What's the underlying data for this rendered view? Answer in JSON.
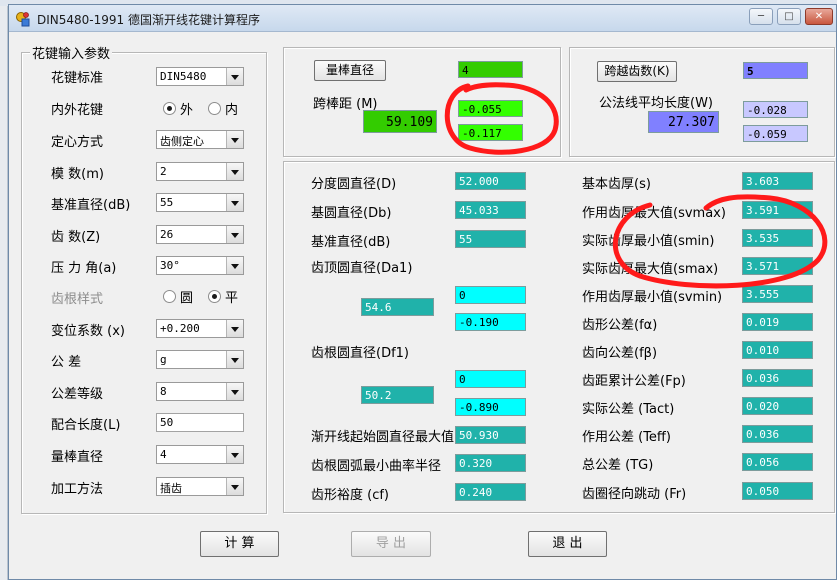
{
  "window": {
    "title": "DIN5480-1991 德国渐开线花键计算程序",
    "controls": [
      "─",
      "□",
      "✕"
    ]
  },
  "input_group": {
    "title": "花键输入参数",
    "rows": [
      {
        "label": "花键标准",
        "value": "DIN5480"
      },
      {
        "label": "内外花键",
        "radio": [
          "外",
          "内"
        ],
        "selected": "外"
      },
      {
        "label": "定心方式",
        "value": "齿侧定心"
      },
      {
        "label": "模     数(m)",
        "value": "2"
      },
      {
        "label": "基准直径(dB)",
        "value": "55"
      },
      {
        "label": "齿     数(Z)",
        "value": "26"
      },
      {
        "label": "压 力 角(a)",
        "value": "30°"
      },
      {
        "label": "齿根样式",
        "radio": [
          "圆",
          "平"
        ],
        "selected": "平"
      },
      {
        "label": "变位系数 (x)",
        "value": "+0.200"
      },
      {
        "label": "公     差",
        "value": "g"
      },
      {
        "label": "公差等级",
        "value": "8"
      },
      {
        "label": "配合长度(L)",
        "value": "50"
      },
      {
        "label": "量棒直径",
        "value": "4"
      },
      {
        "label": "加工方法",
        "value": "插齿"
      }
    ]
  },
  "pin_group": {
    "button_label": "量棒直径",
    "diameter_value": "4",
    "distance_label": "跨棒距 (M)",
    "distance_value": "59.109",
    "dev_upper": "-0.055",
    "dev_lower": "-0.117"
  },
  "span_group": {
    "button_label": "跨越齿数(K)",
    "k_value": "5",
    "length_label": "公法线平均长度(W)",
    "length_value": "27.307",
    "dev_upper": "-0.028",
    "dev_lower": "-0.059"
  },
  "results_left": {
    "pitch_diameter": {
      "label": "分度圆直径(D)",
      "value": "52.000"
    },
    "base_diameter": {
      "label": "基圆直径(Db)",
      "value": "45.033"
    },
    "reference_diameter": {
      "label": "基准直径(dB)",
      "value": "55"
    },
    "tip_diameter": {
      "label": "齿顶圆直径(Da1)",
      "value": "54.6",
      "dev_upper": "0",
      "dev_lower": "-0.190"
    },
    "root_diameter": {
      "label": "齿根圆直径(Df1)",
      "value": "50.2",
      "dev_upper": "0",
      "dev_lower": "-0.890"
    },
    "form_diameter": {
      "label": "渐开线起始圆直径最大值",
      "value": "50.930"
    },
    "root_radius": {
      "label": "齿根圆弧最小曲率半径",
      "value": "0.320"
    },
    "form_clearance": {
      "label": "齿形裕度 (cf)",
      "value": "0.240"
    }
  },
  "results_right": [
    {
      "label": "基本齿厚(s)",
      "value": "3.603"
    },
    {
      "label": "作用齿厚最大值(svmax)",
      "value": "3.591"
    },
    {
      "label": "实际齿厚最小值(smin)",
      "value": "3.535"
    },
    {
      "label": "实际齿厚最大值(smax)",
      "value": "3.571"
    },
    {
      "label": "作用齿厚最小值(svmin)",
      "value": "3.555"
    },
    {
      "label": "齿形公差(fα)",
      "value": "0.019"
    },
    {
      "label": "齿向公差(fβ)",
      "value": "0.010"
    },
    {
      "label": "齿距累计公差(Fp)",
      "value": "0.036"
    },
    {
      "label": "实际公差 (Tact)",
      "value": "0.020"
    },
    {
      "label": "作用公差 (Teff)",
      "value": "0.036"
    },
    {
      "label": "总公差 (TG)",
      "value": "0.056"
    },
    {
      "label": "齿圈径向跳动 (Fr)",
      "value": "0.050"
    }
  ],
  "buttons": {
    "calculate": "计 算",
    "export": "导 出",
    "exit": "退 出"
  },
  "annotation_color": "#ff1a1a",
  "colors": {
    "teal": "#20b2aa",
    "cyan": "#00ffff",
    "green": "#33cc00",
    "lime": "#33ff00",
    "blue": "#8080ff",
    "lavender": "#c8c8ff",
    "window_bg": "#f0f0f0"
  }
}
